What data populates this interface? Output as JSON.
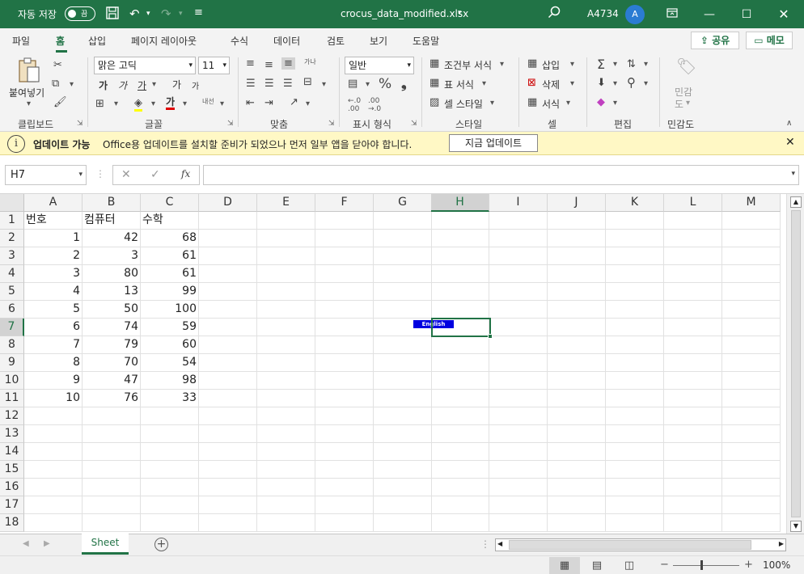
{
  "titlebar": {
    "autosave_label": "자동 저장",
    "autosave_state": "끔",
    "filename": "crocus_data_modified.xlsx",
    "user_name": "A4734",
    "avatar_initial": "A"
  },
  "menu": {
    "tabs": [
      "파일",
      "홈",
      "삽입",
      "페이지 레이아웃",
      "수식",
      "데이터",
      "검토",
      "보기",
      "도움말"
    ],
    "share_label": "공유",
    "memo_label": "메모"
  },
  "ribbon": {
    "clipboard": {
      "paste_label": "붙여넣기",
      "group_label": "클립보드"
    },
    "font": {
      "font_name": "맑은 고딕",
      "font_size": "11",
      "group_label": "글꼴",
      "bold": "가",
      "italic": "가",
      "underline": "가",
      "grow": "가",
      "shrink": "가",
      "color_letter": "가",
      "phonetic": "내선"
    },
    "alignment": {
      "wrap_label": "가나",
      "group_label": "맞춤"
    },
    "number": {
      "format": "일반",
      "group_label": "표시 형식"
    },
    "styles": {
      "conditional_label": "조건부 서식",
      "table_label": "표 서식",
      "cell_style_label": "셀 스타일",
      "group_label": "스타일"
    },
    "cells": {
      "insert_label": "삽입",
      "delete_label": "삭제",
      "format_label": "서식",
      "group_label": "셀"
    },
    "editing": {
      "group_label": "편집"
    },
    "sensitivity": {
      "label_line1": "민감",
      "label_line2": "도",
      "group_label": "민감도"
    }
  },
  "infobar": {
    "title": "업데이트 가능",
    "message": "Office용 업데이트를 설치할 준비가 되었으나 먼저 일부 앱을 닫아야 합니다.",
    "button_label": "지금 업데이트"
  },
  "formulabar": {
    "name_box": "H7",
    "formula": ""
  },
  "grid": {
    "columns": [
      "A",
      "B",
      "C",
      "D",
      "E",
      "F",
      "G",
      "H",
      "I",
      "J",
      "K",
      "L",
      "M"
    ],
    "selected_column": "H",
    "selected_row": "7",
    "rows": [
      {
        "num": "1",
        "cells": [
          "번호",
          "컴퓨터",
          "수학"
        ]
      },
      {
        "num": "2",
        "cells": [
          "1",
          "42",
          "68"
        ]
      },
      {
        "num": "3",
        "cells": [
          "2",
          "3",
          "61"
        ]
      },
      {
        "num": "4",
        "cells": [
          "3",
          "80",
          "61"
        ]
      },
      {
        "num": "5",
        "cells": [
          "4",
          "13",
          "99"
        ]
      },
      {
        "num": "6",
        "cells": [
          "5",
          "50",
          "100"
        ]
      },
      {
        "num": "7",
        "cells": [
          "6",
          "74",
          "59"
        ]
      },
      {
        "num": "8",
        "cells": [
          "7",
          "79",
          "60"
        ]
      },
      {
        "num": "9",
        "cells": [
          "8",
          "70",
          "54"
        ]
      },
      {
        "num": "10",
        "cells": [
          "9",
          "47",
          "98"
        ]
      },
      {
        "num": "11",
        "cells": [
          "10",
          "76",
          "33"
        ]
      },
      {
        "num": "12",
        "cells": []
      },
      {
        "num": "13",
        "cells": []
      },
      {
        "num": "14",
        "cells": []
      },
      {
        "num": "15",
        "cells": []
      },
      {
        "num": "16",
        "cells": []
      },
      {
        "num": "17",
        "cells": []
      },
      {
        "num": "18",
        "cells": []
      }
    ],
    "ime_indicator": "English"
  },
  "sheets": {
    "tabs": [
      "Sheet"
    ]
  },
  "statusbar": {
    "zoom": "100%"
  },
  "colors": {
    "brand": "#217346",
    "infobar_bg": "#fff8c5"
  }
}
